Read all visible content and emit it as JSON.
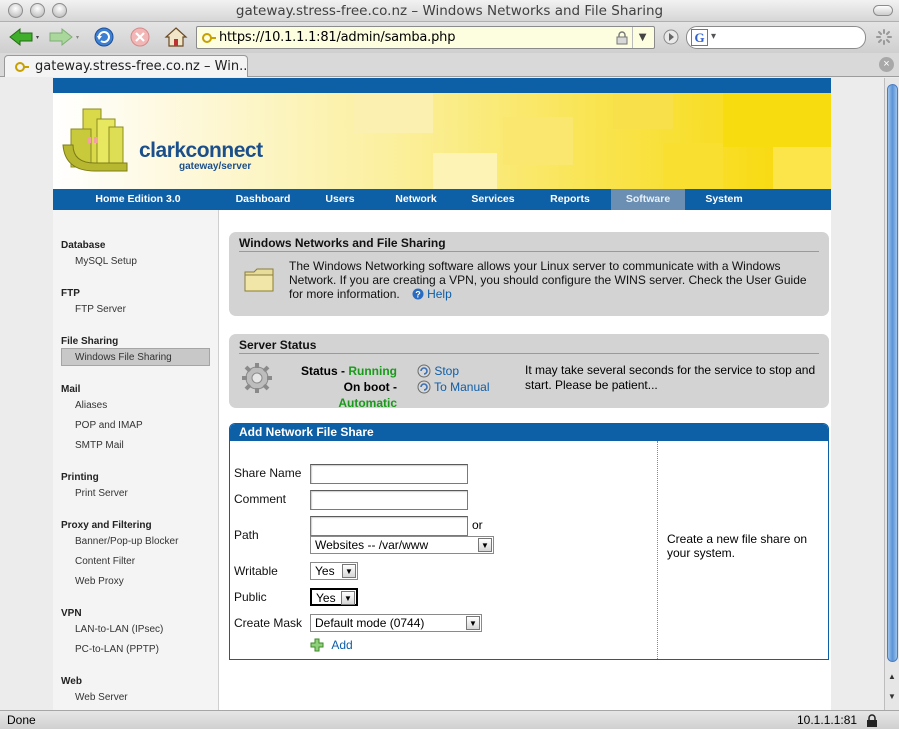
{
  "window": {
    "title": "gateway.stress-free.co.nz – Windows Networks and File Sharing"
  },
  "toolbar": {
    "url": "https://10.1.1.1:81/admin/samba.php",
    "search_placeholder": ""
  },
  "tab": {
    "label": "gateway.stress-free.co.nz – Win..."
  },
  "status_bar": {
    "left": "Done",
    "right": "10.1.1.1:81"
  },
  "logo": {
    "name": "clarkconnect",
    "tagline": "gateway/server"
  },
  "nav": {
    "edition": "Home Edition 3.0",
    "items": [
      "Dashboard",
      "Users",
      "Network",
      "Services",
      "Reports",
      "Software",
      "System"
    ],
    "active": "Software"
  },
  "sidebar": {
    "database": {
      "heading": "Database",
      "links": [
        "MySQL Setup"
      ]
    },
    "ftp": {
      "heading": "FTP",
      "links": [
        "FTP Server"
      ]
    },
    "file_sharing": {
      "heading": "File Sharing",
      "links": [
        "Windows File Sharing"
      ]
    },
    "mail": {
      "heading": "Mail",
      "links": [
        "Aliases",
        "POP and IMAP",
        "SMTP Mail"
      ]
    },
    "printing": {
      "heading": "Printing",
      "links": [
        "Print Server"
      ]
    },
    "proxy": {
      "heading": "Proxy and Filtering",
      "links": [
        "Banner/Pop-up Blocker",
        "Content Filter",
        "Web Proxy"
      ]
    },
    "vpn": {
      "heading": "VPN",
      "links": [
        "LAN-to-LAN (IPsec)",
        "PC-to-LAN (PPTP)"
      ]
    },
    "web": {
      "heading": "Web",
      "links": [
        "Web Server"
      ]
    }
  },
  "intro": {
    "title": "Windows Networks and File Sharing",
    "line1": "The Windows Networking software allows your Linux server to communicate with a Windows",
    "line2": "Network.  If you are creating a VPN, you should configure the WINS server.  Check the User Guide",
    "line3": "for more information.",
    "help_label": "Help"
  },
  "server_status": {
    "title": "Server Status",
    "status_label": "Status -",
    "status_value": "Running",
    "boot_label": "On boot -",
    "boot_value": "Automatic",
    "stop_label": "Stop",
    "manual_label": "To Manual",
    "note_line1": "It may take several seconds for the service to stop and",
    "note_line2": "start.  Please be patient...",
    "status_color": "#1a9a1a"
  },
  "add_share": {
    "title": "Add Network File Share",
    "share_name_label": "Share Name",
    "share_name_value": "",
    "comment_label": "Comment",
    "comment_value": "",
    "path_label": "Path",
    "path_value": "",
    "path_or": "or",
    "path_select": "Websites -- /var/www",
    "writable_label": "Writable",
    "writable_value": "Yes",
    "public_label": "Public",
    "public_value": "Yes",
    "mask_label": "Create Mask",
    "mask_value": "Default mode (0744)",
    "add_label": "Add",
    "help_line1": "Create a new file share on",
    "help_line2": "your system."
  },
  "colors": {
    "brand_blue": "#0d5fa6",
    "link": "#0e5ea8",
    "banner_yellow": "#f7d800"
  }
}
